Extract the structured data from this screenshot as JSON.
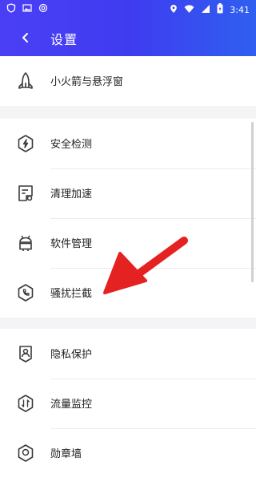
{
  "status_bar": {
    "time": "3:41",
    "icons_left": [
      "shield-icon",
      "image-icon",
      "at-icon"
    ],
    "icons_right": [
      "location-icon",
      "wifi-icon",
      "signal-icon",
      "battery-icon"
    ]
  },
  "header": {
    "title": "设置",
    "back_icon": "chevron-left-icon",
    "gradient_start": "#4b3ff5",
    "gradient_end": "#2f5ff0"
  },
  "settings": {
    "group1": [
      {
        "label": "小火箭与悬浮窗",
        "icon": "rocket-icon"
      }
    ],
    "group2": [
      {
        "label": "安全检测",
        "icon": "security-check-icon"
      },
      {
        "label": "清理加速",
        "icon": "cleanup-icon"
      },
      {
        "label": "软件管理",
        "icon": "android-icon"
      },
      {
        "label": "骚扰拦截",
        "icon": "phone-block-icon"
      }
    ],
    "group3": [
      {
        "label": "隐私保护",
        "icon": "privacy-icon"
      },
      {
        "label": "流量监控",
        "icon": "traffic-icon"
      },
      {
        "label": "勋章墙",
        "icon": "medal-icon"
      }
    ]
  },
  "annotation": {
    "arrow_color": "#e52222"
  }
}
